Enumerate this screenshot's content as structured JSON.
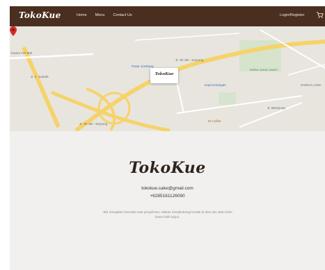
{
  "navbar": {
    "brand": "TokoKue",
    "links": [
      "Home",
      "Menu",
      "Contact Us"
    ],
    "login_label": "Login/Register",
    "cart_icon": "cart-icon",
    "background_color": "#4a2e1f"
  },
  "map": {
    "labels": {
      "kantor": "Kantor TPI 800",
      "pasar": "Pasar Jombang",
      "road_top": "Jl. Tol JW - Serpong",
      "road_bottom": "Jl. Tol JW - Serpong",
      "road_left": "Jl. Ir. Juanda",
      "kopi": "Kopi Kenangan",
      "kebun": "Kebun Jurus Lasem",
      "sawah": "SAWAH LAMA",
      "coffee": "Et Coffee",
      "road_right": "Jl. Meruyung"
    },
    "card_logo": "TokoKue",
    "pin_color": "#d62b2b"
  },
  "footer": {
    "logo": "TokoKue",
    "email": "tokokue.cake@gmail.com",
    "phone": "+6285161126090",
    "description": "Jika mengalami kendala saat pengiriman, silakan menghubungi kontak di atas dan akan kami bantu lebih lanjut."
  }
}
